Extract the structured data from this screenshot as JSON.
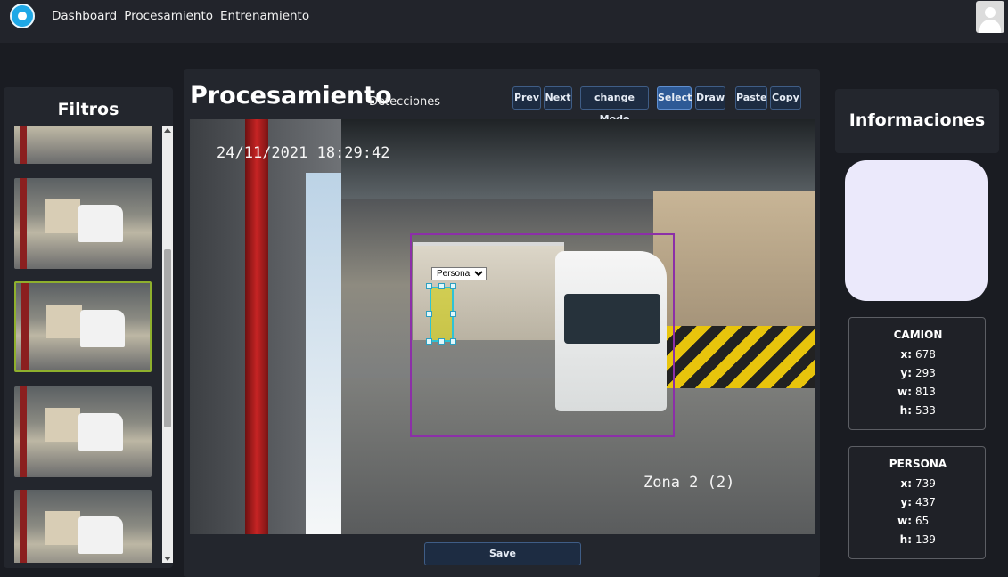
{
  "nav": {
    "links": [
      "Dashboard",
      "Procesamiento",
      "Entrenamiento"
    ]
  },
  "filters": {
    "title": "Filtros",
    "thumbnail_count": 5,
    "selected_index": 2
  },
  "main": {
    "title": "Procesamiento",
    "subtitle": "Detecciones",
    "toolbar": {
      "prev": "Prev",
      "next": "Next",
      "change_mode": "change Mode",
      "select": "Select",
      "draw": "Draw",
      "paste": "Paste",
      "copy": "Copy",
      "active": "Select"
    },
    "viewer": {
      "timestamp": "24/11/2021 18:29:42",
      "zone": "Zona 2 (2)",
      "class_selected": "Persona",
      "class_options": [
        "Persona"
      ]
    },
    "save": "Save"
  },
  "info": {
    "title": "Informaciones",
    "detections": [
      {
        "name": "CAMION",
        "x": "678",
        "y": "293",
        "w": "813",
        "h": "533"
      },
      {
        "name": "PERSONA",
        "x": "739",
        "y": "437",
        "w": "65",
        "h": "139"
      }
    ],
    "field_labels": {
      "x": "x:",
      "y": "y:",
      "w": "w:",
      "h": "h:"
    }
  },
  "colors": {
    "background": "#1a1c22",
    "panel": "#23262d",
    "accent_button": "#2e5a96",
    "bbox_camion": "#8c2fa8",
    "bbox_persona": "#2ec3d6",
    "preview_card": "#ebe9fb"
  },
  "icons": {
    "logo": "app-logo-icon",
    "avatar": "user-avatar-icon"
  }
}
